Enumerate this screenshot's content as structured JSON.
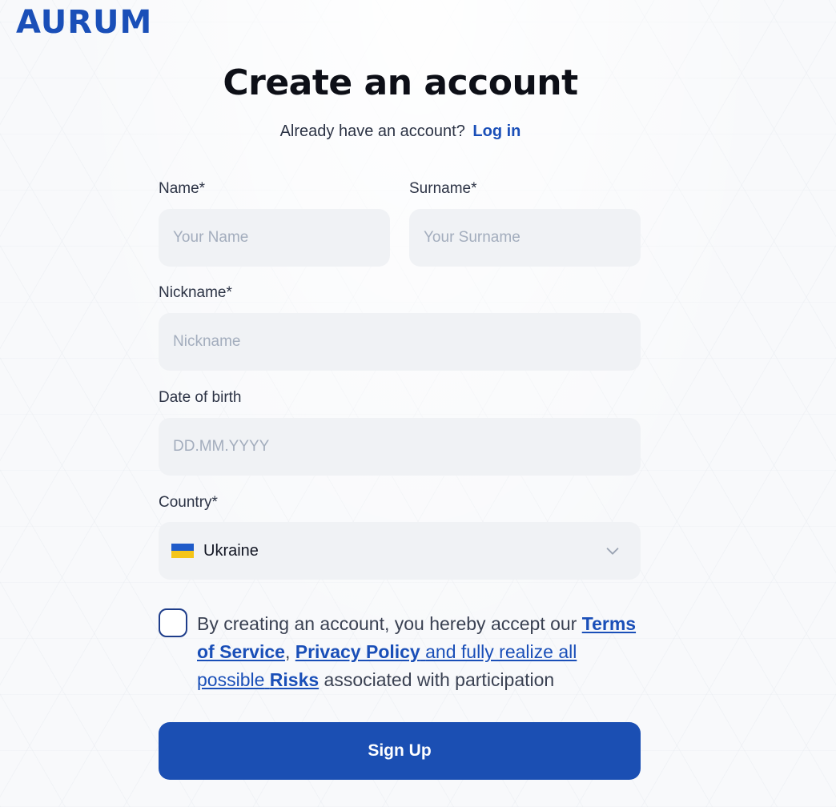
{
  "brand": {
    "logo_text": "AURUM",
    "color": "#1a4fb8"
  },
  "header": {
    "title": "Create an account",
    "subtitle_text": "Already have an account?",
    "login_link": "Log in"
  },
  "form": {
    "name": {
      "label": "Name*",
      "placeholder": "Your Name",
      "value": ""
    },
    "surname": {
      "label": "Surname*",
      "placeholder": "Your Surname",
      "value": ""
    },
    "nickname": {
      "label": "Nickname*",
      "placeholder": "Nickname",
      "value": ""
    },
    "dob": {
      "label": "Date of birth",
      "placeholder": "DD.MM.YYYY",
      "value": ""
    },
    "country": {
      "label": "Country*",
      "value": "Ukraine",
      "flag_icon": "ukraine-flag-icon",
      "flag_colors": [
        "#1f5bc9",
        "#f5c518"
      ]
    },
    "terms": {
      "checked": false,
      "text_1": "By creating an account, you hereby accept our",
      "tos": "Terms of Service",
      "comma": ",",
      "privacy": "Privacy Policy",
      "text_2": "and fully realize all possible",
      "risks": "Risks",
      "text_3": "associated with participation"
    },
    "submit_label": "Sign Up"
  },
  "colors": {
    "accent": "#1b4fb3",
    "field_bg": "#f0f2f5",
    "placeholder": "#a3adbd"
  }
}
